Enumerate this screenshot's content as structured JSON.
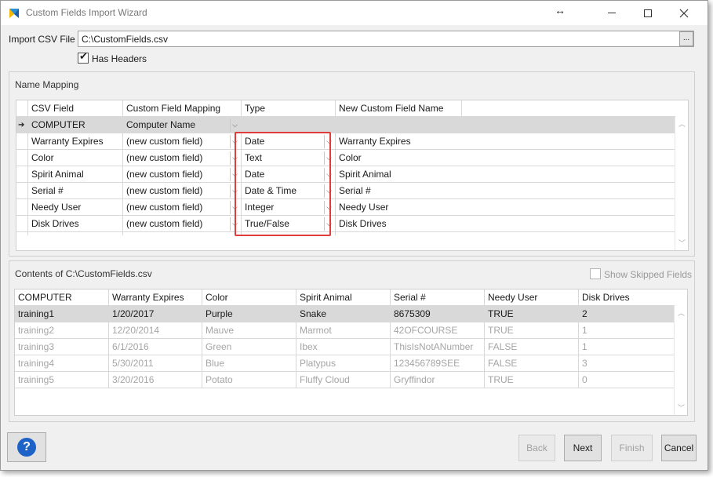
{
  "window": {
    "title": "Custom Fields Import Wizard"
  },
  "csv": {
    "label": "Import CSV File",
    "value": "C:\\CustomFields.csv",
    "browse_label": "...",
    "has_headers_label": "Has Headers",
    "has_headers": true
  },
  "mapping": {
    "title": "Name Mapping",
    "headers": [
      "CSV Field",
      "Custom Field Mapping",
      "Type",
      "New Custom Field Name"
    ],
    "rows": [
      {
        "field": "COMPUTER",
        "mapping": "Computer Name",
        "type": "",
        "new_name": ""
      },
      {
        "field": "Warranty Expires",
        "mapping": "(new custom field)",
        "type": "Date",
        "new_name": "Warranty Expires"
      },
      {
        "field": "Color",
        "mapping": "(new custom field)",
        "type": "Text",
        "new_name": "Color"
      },
      {
        "field": "Spirit Animal",
        "mapping": "(new custom field)",
        "type": "Date",
        "new_name": "Spirit Animal"
      },
      {
        "field": "Serial #",
        "mapping": "(new custom field)",
        "type": "Date & Time",
        "new_name": "Serial #"
      },
      {
        "field": "Needy User",
        "mapping": "(new custom field)",
        "type": "Integer",
        "new_name": "Needy User"
      },
      {
        "field": "Disk Drives",
        "mapping": "(new custom field)",
        "type": "True/False",
        "new_name": "Disk Drives"
      }
    ]
  },
  "contents": {
    "title": "Contents of C:\\CustomFields.csv",
    "show_skipped_label": "Show Skipped Fields",
    "headers": [
      "COMPUTER",
      "Warranty Expires",
      "Color",
      "Spirit Animal",
      "Serial #",
      "Needy User",
      "Disk Drives"
    ],
    "rows": [
      [
        "training1",
        "1/20/2017",
        "Purple",
        "Snake",
        "8675309",
        "TRUE",
        "2"
      ],
      [
        "training2",
        "12/20/2014",
        "Mauve",
        "Marmot",
        "42OFCOURSE",
        "TRUE",
        "1"
      ],
      [
        "training3",
        "6/1/2016",
        "Green",
        "Ibex",
        "ThisIsNotANumber",
        "FALSE",
        "1"
      ],
      [
        "training4",
        "5/30/2011",
        "Blue",
        "Platypus",
        "123456789SEE",
        "FALSE",
        "3"
      ],
      [
        "training5",
        "3/20/2016",
        "Potato",
        "Fluffy Cloud",
        "Gryffindor",
        "TRUE",
        "0"
      ]
    ]
  },
  "buttons": {
    "back": "Back",
    "next": "Next",
    "finish": "Finish",
    "cancel": "Cancel",
    "help": "?"
  },
  "colors": {
    "highlight": "#e03c3c",
    "help_blue": "#1d63c7",
    "selected_row": "#d9d9d9"
  },
  "icons": {
    "app": "app-logo-icon",
    "resize": "resize-horizontal-icon",
    "current_row": "row-pointer-icon"
  }
}
